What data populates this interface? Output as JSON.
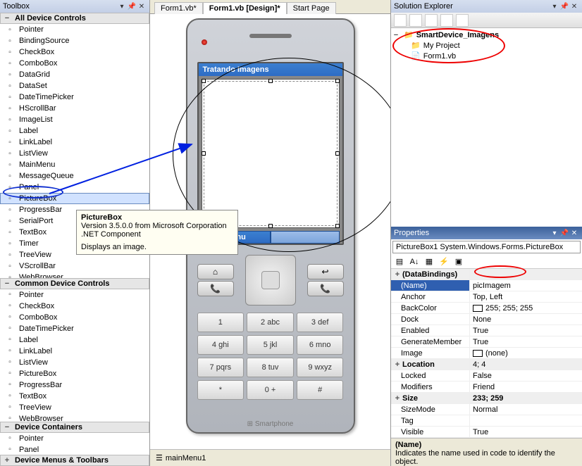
{
  "toolbox": {
    "title": "Toolbox",
    "sections": [
      {
        "label": "All Device Controls",
        "items": [
          "Pointer",
          "BindingSource",
          "CheckBox",
          "ComboBox",
          "DataGrid",
          "DataSet",
          "DateTimePicker",
          "HScrollBar",
          "ImageList",
          "Label",
          "LinkLabel",
          "ListView",
          "MainMenu",
          "MessageQueue",
          "Panel",
          "PictureBox",
          "ProgressBar",
          "SerialPort",
          "TextBox",
          "Timer",
          "TreeView",
          "VScrollBar",
          "WebBrowser"
        ],
        "selected_index": 15
      },
      {
        "label": "Common Device Controls",
        "items": [
          "Pointer",
          "CheckBox",
          "ComboBox",
          "DateTimePicker",
          "Label",
          "LinkLabel",
          "ListView",
          "PictureBox",
          "ProgressBar",
          "TextBox",
          "TreeView",
          "WebBrowser"
        ]
      },
      {
        "label": "Device Containers",
        "items": [
          "Pointer",
          "Panel"
        ]
      },
      {
        "label": "Device Menus & Toolbars",
        "items": []
      }
    ]
  },
  "tooltip": {
    "title": "PictureBox",
    "line1": "Version 3.5.0.0 from Microsoft Corporation",
    "line2": ".NET Component",
    "desc": "Displays an image."
  },
  "tabs": {
    "items": [
      "Form1.vb*",
      "Form1.vb [Design]*",
      "Start Page"
    ],
    "active_index": 1
  },
  "phone": {
    "app_title": "Tratando Imagens",
    "softkey_left": "Menu",
    "brand": "Smartphone",
    "keypad": [
      "1",
      "2 abc",
      "3 def",
      "4 ghi",
      "5 jkl",
      "6 mno",
      "7 pqrs",
      "8 tuv",
      "9 wxyz",
      "*",
      "0 +",
      "#"
    ]
  },
  "tray": {
    "item": "mainMenu1"
  },
  "solution": {
    "title": "Solution Explorer",
    "root": "SmartDevice_Imagens",
    "children": [
      "My Project",
      "Form1.vb"
    ]
  },
  "properties": {
    "title": "Properties",
    "object": "PictureBox1  System.Windows.Forms.PictureBox",
    "rows": [
      {
        "cat": true,
        "name": "(DataBindings)",
        "val": ""
      },
      {
        "name": "(Name)",
        "val": "picImagem",
        "selected": true
      },
      {
        "name": "Anchor",
        "val": "Top, Left"
      },
      {
        "name": "BackColor",
        "val": "255; 255; 255",
        "swatch": true
      },
      {
        "name": "Dock",
        "val": "None"
      },
      {
        "name": "Enabled",
        "val": "True"
      },
      {
        "name": "GenerateMember",
        "val": "True"
      },
      {
        "name": "Image",
        "val": "(none)",
        "swatch": true
      },
      {
        "cat": true,
        "expander": "+",
        "name": "Location",
        "val": "4; 4"
      },
      {
        "name": "Locked",
        "val": "False"
      },
      {
        "name": "Modifiers",
        "val": "Friend"
      },
      {
        "cat": true,
        "expander": "+",
        "name": "Size",
        "val": "233; 259",
        "bold_val": true
      },
      {
        "name": "SizeMode",
        "val": "Normal"
      },
      {
        "name": "Tag",
        "val": ""
      },
      {
        "name": "Visible",
        "val": "True"
      }
    ],
    "desc_title": "(Name)",
    "desc_body": "Indicates the name used in code to identify the object."
  }
}
